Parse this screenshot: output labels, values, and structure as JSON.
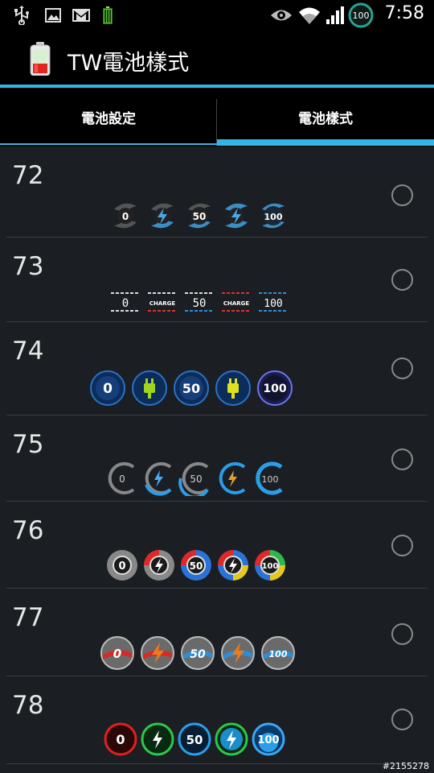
{
  "status_bar": {
    "time": "7:58",
    "battery_level": "100",
    "icons": [
      "usb-icon",
      "image-icon",
      "gmail-icon",
      "battery-green-icon",
      "eye-icon",
      "wifi-icon",
      "signal-icon",
      "battery-ring-icon"
    ]
  },
  "action_bar": {
    "title": "TW電池樣式"
  },
  "tabs": [
    {
      "label": "電池設定",
      "selected": false
    },
    {
      "label": "電池樣式",
      "selected": true
    }
  ],
  "styles": [
    {
      "number": "72",
      "preview": [
        "0",
        "charge",
        "50",
        "charge",
        "100"
      ]
    },
    {
      "number": "73",
      "preview": [
        "0",
        "CHARGE",
        "50",
        "CHARGE",
        "100"
      ]
    },
    {
      "number": "74",
      "preview": [
        "0",
        "charge",
        "50",
        "charge",
        "100"
      ]
    },
    {
      "number": "75",
      "preview": [
        "0",
        "charge",
        "50",
        "charge",
        "100"
      ]
    },
    {
      "number": "76",
      "preview": [
        "0",
        "charge",
        "50",
        "charge",
        "100"
      ]
    },
    {
      "number": "77",
      "preview": [
        "0",
        "charge",
        "50",
        "charge",
        "100"
      ]
    },
    {
      "number": "78",
      "preview": [
        "0",
        "charge",
        "50",
        "charge",
        "100"
      ]
    }
  ],
  "watermark": "#2155278",
  "colors": {
    "accent": "#33b5e5",
    "background": "#1b1e22"
  }
}
